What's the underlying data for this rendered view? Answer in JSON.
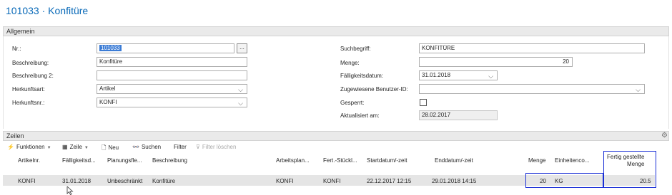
{
  "page": {
    "title": "101033 · Konfitüre"
  },
  "general": {
    "section_label": "Allgemein",
    "left": {
      "nr_label": "Nr.:",
      "nr_value": "101033",
      "nr_button": "...",
      "desc_label": "Beschreibung:",
      "desc_value": "Konfitüre",
      "desc2_label": "Beschreibung 2:",
      "desc2_value": "",
      "source_type_label": "Herkunftsart:",
      "source_type_value": "Artikel",
      "source_no_label": "Herkunftsnr.:",
      "source_no_value": "KONFI"
    },
    "right": {
      "search_label": "Suchbegriff:",
      "search_value": "KONFITÜRE",
      "qty_label": "Menge:",
      "qty_value": "20",
      "due_label": "Fälligkeitsdatum:",
      "due_value": "31.01.2018",
      "user_label": "Zugewiesene Benutzer-ID:",
      "user_value": "",
      "blocked_label": "Gesperrt:",
      "blocked_checked": false,
      "updated_label": "Aktualisiert am:",
      "updated_value": "28.02.2017"
    }
  },
  "lines": {
    "section_label": "Zeilen",
    "toolbar": {
      "functions": "Funktionen",
      "line": "Zeile",
      "new": "Neu",
      "search": "Suchen",
      "filter": "Filter",
      "clear_filter": "Filter löschen"
    },
    "columns": {
      "item_no": "Artikelnr.",
      "due": "Fälligkeitsd...",
      "planning": "Planungsfle...",
      "description": "Beschreibung",
      "routing": "Arbeitsplan...",
      "bom": "Fert.-Stückl...",
      "start": "Startdatum/-zeit",
      "end": "Enddatum/-zeit",
      "qty": "Menge",
      "unit": "Einheitenco...",
      "finished_1": "Fertig gestellte",
      "finished_2": "Menge"
    },
    "rows": [
      {
        "item_no": "KONFI",
        "due": "31.01.2018",
        "planning": "Unbeschränkt",
        "description": "Konfitüre",
        "routing": "KONFI",
        "bom": "KONFI",
        "start": "22.12.2017 12:15",
        "end": "29.01.2018 14:15",
        "qty": "20",
        "unit": "KG",
        "finished": "20.5"
      }
    ]
  },
  "colors": {
    "title": "#0a6ab8",
    "highlight": "#1a2fd6",
    "selection": "#3a7bd5",
    "function_icon": "#e8a400"
  },
  "icons": [
    "lightning-icon",
    "grid-icon",
    "new-document-icon",
    "binoculars-icon",
    "clear-filter-icon",
    "settings-icon",
    "mouse-cursor-icon"
  ]
}
